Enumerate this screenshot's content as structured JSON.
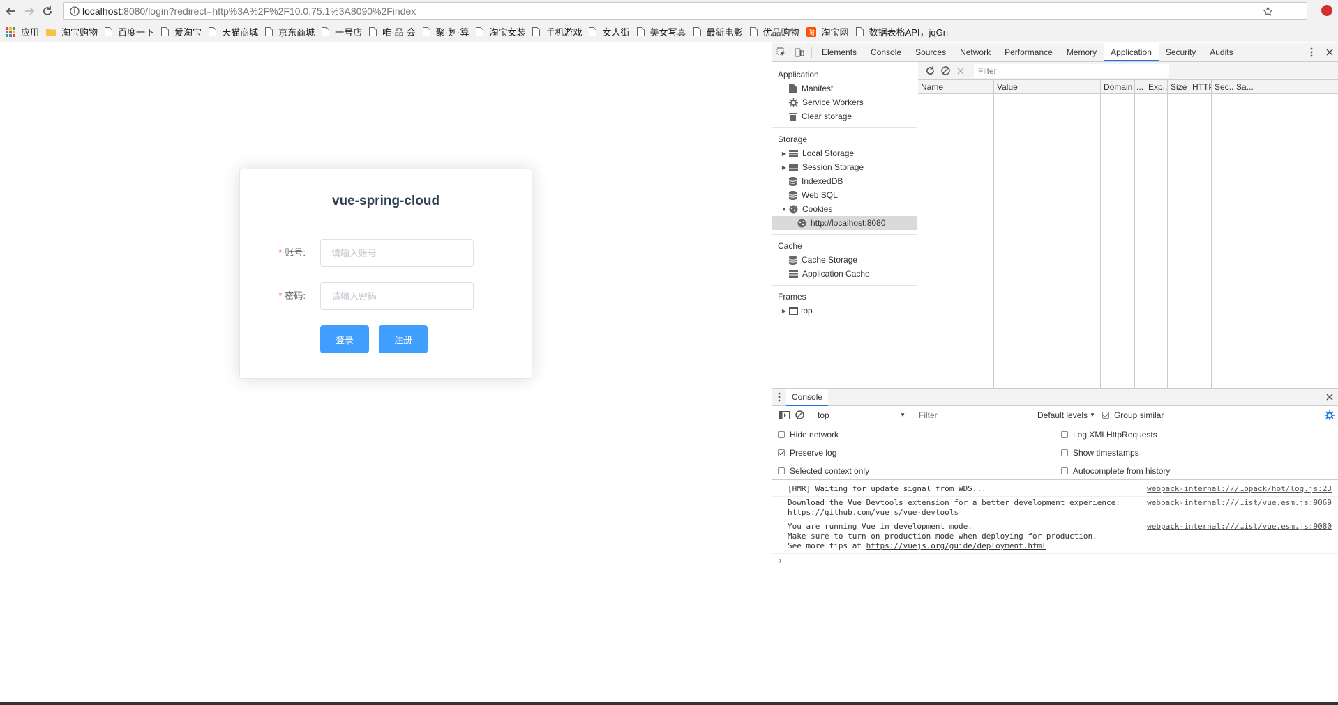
{
  "browser": {
    "url_host": "localhost",
    "url_rest": ":8080/login?redirect=http%3A%2F%2F10.0.75.1%3A8090%2Findex",
    "bookmarks": [
      {
        "label": "应用",
        "icon": "apps-grid-icon"
      },
      {
        "label": "淘宝购物",
        "icon": "folder-icon"
      },
      {
        "label": "百度一下",
        "icon": "page-icon"
      },
      {
        "label": "爱淘宝",
        "icon": "page-icon"
      },
      {
        "label": "天猫商城",
        "icon": "page-icon"
      },
      {
        "label": "京东商城",
        "icon": "page-icon"
      },
      {
        "label": "一号店",
        "icon": "page-icon"
      },
      {
        "label": "唯·品·会",
        "icon": "page-icon"
      },
      {
        "label": "聚·划·算",
        "icon": "page-icon"
      },
      {
        "label": "淘宝女装",
        "icon": "page-icon"
      },
      {
        "label": "手机游戏",
        "icon": "page-icon"
      },
      {
        "label": "女人街",
        "icon": "page-icon"
      },
      {
        "label": "美女写真",
        "icon": "page-icon"
      },
      {
        "label": "最新电影",
        "icon": "page-icon"
      },
      {
        "label": "优品购物",
        "icon": "page-icon"
      },
      {
        "label": "淘宝网",
        "icon": "taobao-icon"
      },
      {
        "label": "数据表格API，jqGri",
        "icon": "page-icon"
      }
    ]
  },
  "login": {
    "title": "vue-spring-cloud",
    "account_label": "账号:",
    "account_placeholder": "请输入账号",
    "password_label": "密码:",
    "password_placeholder": "请输入密码",
    "login_button": "登录",
    "register_button": "注册"
  },
  "devtools": {
    "tabs": [
      "Elements",
      "Console",
      "Sources",
      "Network",
      "Performance",
      "Memory",
      "Application",
      "Security",
      "Audits"
    ],
    "active_tab": "Application",
    "sidebar": {
      "application_header": "Application",
      "application_items": [
        "Manifest",
        "Service Workers",
        "Clear storage"
      ],
      "storage_header": "Storage",
      "storage_items": [
        "Local Storage",
        "Session Storage",
        "IndexedDB",
        "Web SQL",
        "Cookies"
      ],
      "cookie_origin": "http://localhost:8080",
      "cache_header": "Cache",
      "cache_items": [
        "Cache Storage",
        "Application Cache"
      ],
      "frames_header": "Frames",
      "frames_item": "top"
    },
    "cookies": {
      "filter_placeholder": "Filter",
      "columns": [
        "Name",
        "Value",
        "Domain",
        "...",
        "Exp...",
        "Size",
        "HTTP",
        "Sec...",
        "Sa..."
      ]
    },
    "console": {
      "tab": "Console",
      "context": "top",
      "filter_placeholder": "Filter",
      "levels": "Default levels",
      "group_similar": "Group similar",
      "settings": {
        "hide_network": "Hide network",
        "preserve_log": "Preserve log",
        "selected_context_only": "Selected context only",
        "log_xhr": "Log XMLHttpRequests",
        "show_timestamps": "Show timestamps",
        "autocomplete_history": "Autocomplete from history"
      },
      "messages": [
        {
          "lines": [
            "[HMR] Waiting for update signal from WDS..."
          ],
          "source": "webpack-internal:///…bpack/hot/log.js:23"
        },
        {
          "lines": [
            "Download the Vue Devtools extension for a better development experience:"
          ],
          "link": "https://github.com/vuejs/vue-devtools",
          "source": "webpack-internal:///…ist/vue.esm.js:9069"
        },
        {
          "lines": [
            "You are running Vue in development mode.",
            "Make sure to turn on production mode when deploying for production."
          ],
          "tip_prefix": "See more tips at ",
          "link": "https://vuejs.org/guide/deployment.html",
          "source": "webpack-internal:///…ist/vue.esm.js:9080"
        }
      ]
    }
  },
  "colors": {
    "primary": "#409eff",
    "required": "#f56c6c",
    "devtools_accent": "#1a73e8"
  }
}
